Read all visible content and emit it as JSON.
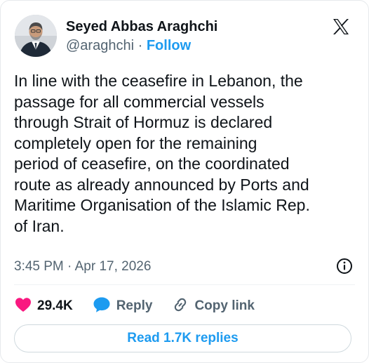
{
  "author": {
    "name": "Seyed Abbas Araghchi",
    "handle": "@araghchi",
    "separator": "·",
    "follow_label": "Follow"
  },
  "post": {
    "lines": [
      "In line with the ceasefire in Lebanon, the",
      "passage for all commercial vessels",
      "through Strait of Hormuz is declared",
      "completely open for the remaining",
      "period of ceasefire, on the coordinated",
      "route as already announced by Ports and",
      "Maritime Organisation of the Islamic Rep.",
      "of Iran."
    ],
    "timestamp": "3:45 PM · Apr 17, 2026"
  },
  "actions": {
    "likes": "29.4K",
    "reply_label": "Reply",
    "copy_label": "Copy link"
  },
  "replies_button": "Read 1.7K replies",
  "icons": {
    "brand": "x-logo-icon",
    "info": "info-icon",
    "like": "heart-icon",
    "reply": "reply-bubble-icon",
    "copy": "link-icon"
  },
  "colors": {
    "accent": "#1d9bf0",
    "like": "#f91880",
    "reply": "#1d9bf0",
    "secondary_text": "#536471"
  }
}
